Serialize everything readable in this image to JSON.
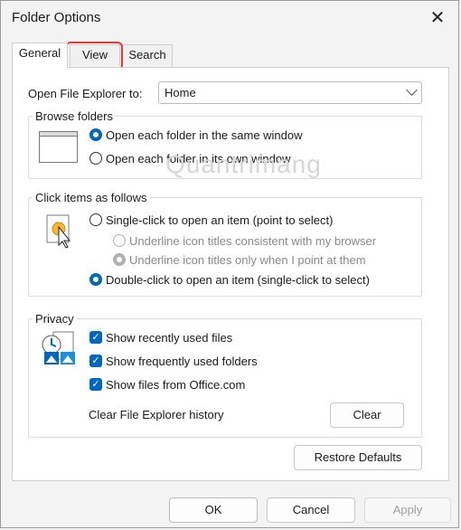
{
  "window": {
    "title": "Folder Options"
  },
  "tabs": [
    {
      "label": "General"
    },
    {
      "label": "View"
    },
    {
      "label": "Search"
    }
  ],
  "open_explorer": {
    "label": "Open File Explorer to:",
    "value": "Home"
  },
  "browse": {
    "title": "Browse folders",
    "options": [
      {
        "label": "Open each folder in the same window",
        "selected": true
      },
      {
        "label": "Open each folder in its own window",
        "selected": false
      }
    ]
  },
  "click": {
    "title": "Click items as follows",
    "single": "Single-click to open an item (point to select)",
    "underline_browser": "Underline icon titles consistent with my browser",
    "underline_point": "Underline icon titles only when I point at them",
    "double": "Double-click to open an item (single-click to select)"
  },
  "privacy": {
    "title": "Privacy",
    "recent_files": "Show recently used files",
    "frequent_folders": "Show frequently used folders",
    "office_files": "Show files from Office.com",
    "clear_label": "Clear File Explorer history",
    "clear_button": "Clear"
  },
  "buttons": {
    "restore": "Restore Defaults",
    "ok": "OK",
    "cancel": "Cancel",
    "apply": "Apply"
  },
  "watermark": "Quantrimang",
  "colors": {
    "accent": "#0067c0",
    "highlight": "#e53935"
  }
}
